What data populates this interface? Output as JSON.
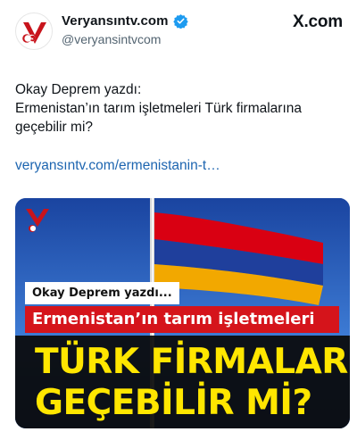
{
  "account": {
    "display_name": "Veryansıntv.com",
    "handle": "@veryansintvcom",
    "verified": true,
    "avatar_icon": "veryansintv-logo-icon"
  },
  "platform": {
    "logo_text": "X.com"
  },
  "tweet": {
    "lines": [
      "Okay Deprem yazdı:",
      "Ermenistan’ın tarım işletmeleri Türk firmalarına",
      "geçebilir mi?"
    ],
    "link": "veryansıntv.com/ermenistanin-t…"
  },
  "card": {
    "label_small": "Okay Deprem yazdı...",
    "label_red": "Ermenistan’ın tarım işletmeleri",
    "headline_line1": "TÜRK FİRMALARINA",
    "headline_line2": "GEÇEBİLİR Mİ?",
    "flag_colors": [
      "#d90012",
      "#0033a0",
      "#f2a800"
    ],
    "accent_red": "#d5141b",
    "headline_color": "#ffe600"
  }
}
